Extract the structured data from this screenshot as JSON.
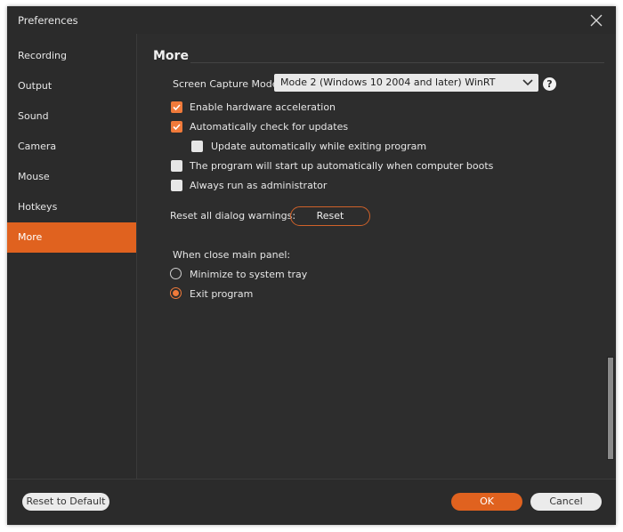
{
  "window": {
    "title": "Preferences",
    "close_icon": "close-icon"
  },
  "sidebar": {
    "items": [
      {
        "label": "Recording",
        "active": false
      },
      {
        "label": "Output",
        "active": false
      },
      {
        "label": "Sound",
        "active": false
      },
      {
        "label": "Camera",
        "active": false
      },
      {
        "label": "Mouse",
        "active": false
      },
      {
        "label": "Hotkeys",
        "active": false
      },
      {
        "label": "More",
        "active": true
      }
    ]
  },
  "content": {
    "section_title": "More",
    "capture_mode": {
      "label": "Screen Capture Mode:",
      "value": "Mode 2 (Windows 10 2004 and later) WinRT",
      "help_icon": "?"
    },
    "options": [
      {
        "label": "Enable hardware acceleration",
        "checked": true
      },
      {
        "label": "Automatically check for updates",
        "checked": true
      },
      {
        "label": "Update automatically while exiting program",
        "checked": false
      },
      {
        "label": "The program will start up automatically when computer boots",
        "checked": false
      },
      {
        "label": "Always run as administrator",
        "checked": false
      }
    ],
    "reset_warnings": {
      "label": "Reset all dialog warnings:",
      "button": "Reset"
    },
    "close_panel": {
      "label": "When close main panel:",
      "options": [
        {
          "label": "Minimize to system tray",
          "selected": false
        },
        {
          "label": "Exit program",
          "selected": true
        }
      ]
    }
  },
  "footer": {
    "reset_default": "Reset to Default",
    "ok": "OK",
    "cancel": "Cancel"
  },
  "colors": {
    "accent": "#e0621f",
    "checkbox_accent": "#f07a3a",
    "background": "#2b2b2b"
  }
}
